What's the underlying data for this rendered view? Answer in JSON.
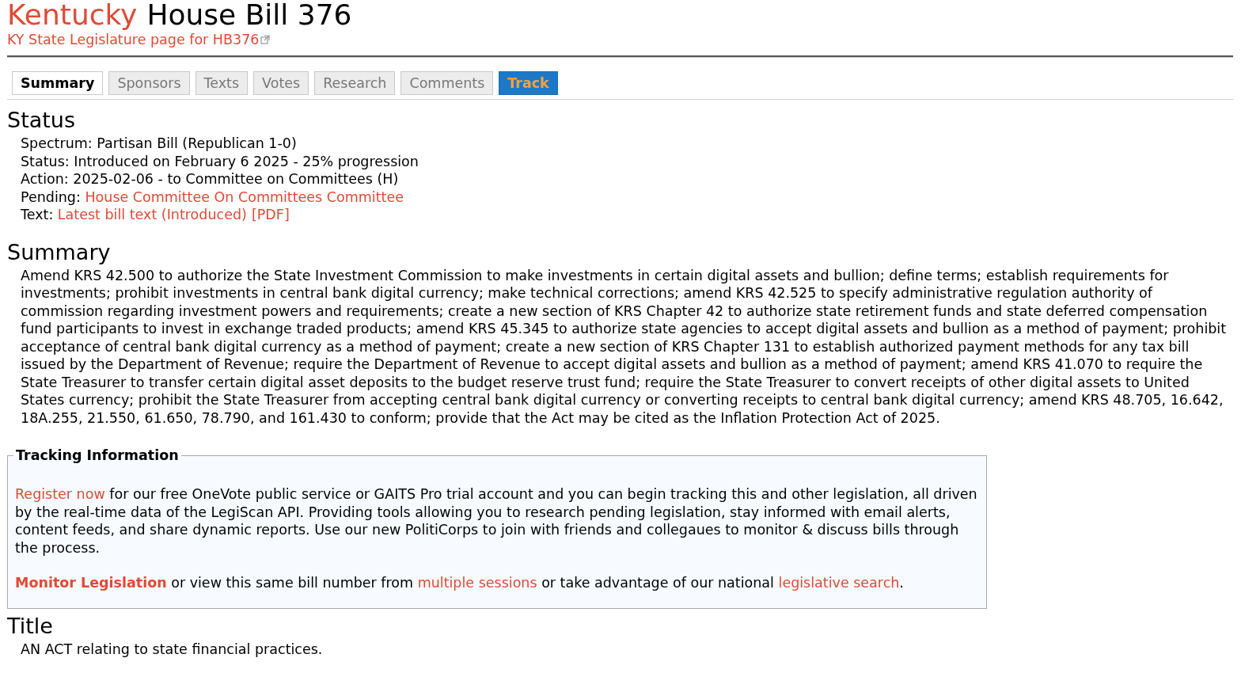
{
  "header": {
    "state": "Kentucky",
    "bill": "House Bill 376",
    "state_link": "KY State Legislature page for HB376"
  },
  "tabs": [
    {
      "label": "Summary",
      "selected": true,
      "kind": "tab"
    },
    {
      "label": "Sponsors",
      "selected": false,
      "kind": "tab"
    },
    {
      "label": "Texts",
      "selected": false,
      "kind": "tab"
    },
    {
      "label": "Votes",
      "selected": false,
      "kind": "tab"
    },
    {
      "label": "Research",
      "selected": false,
      "kind": "tab"
    },
    {
      "label": "Comments",
      "selected": false,
      "kind": "tab"
    },
    {
      "label": "Track",
      "selected": false,
      "kind": "action"
    }
  ],
  "status": {
    "heading": "Status",
    "lines": [
      {
        "parts": [
          {
            "kind": "text",
            "text": "Spectrum: Partisan Bill (Republican 1-0)"
          }
        ]
      },
      {
        "parts": [
          {
            "kind": "text",
            "text": "Status: Introduced on February 6 2025 - 25% progression"
          }
        ]
      },
      {
        "parts": [
          {
            "kind": "text",
            "text": "Action: 2025-02-06 - to Committee on Committees (H)"
          }
        ]
      },
      {
        "parts": [
          {
            "kind": "text",
            "text": "Pending: "
          },
          {
            "kind": "link",
            "text": "House Committee On Committees Committee"
          }
        ]
      },
      {
        "parts": [
          {
            "kind": "text",
            "text": "Text: "
          },
          {
            "kind": "link",
            "text": "Latest bill text (Introduced)"
          },
          {
            "kind": "link",
            "text": "[PDF]"
          }
        ]
      }
    ]
  },
  "summary": {
    "heading": "Summary",
    "text": "Amend KRS 42.500 to authorize the State Investment Commission to make investments in certain digital assets and bullion; define terms; establish requirements for investments; prohibit investments in central bank digital currency; make technical corrections; amend KRS 42.525 to specify administrative regulation authority of commission regarding investment powers and requirements; create a new section of KRS Chapter 42 to authorize state retirement funds and state deferred compensation fund participants to invest in exchange traded products; amend KRS 45.345 to authorize state agencies to accept digital assets and bullion as a method of payment; prohibit acceptance of central bank digital currency as a method of payment; create a new section of KRS Chapter 131 to establish authorized payment methods for any tax bill issued by the Department of Revenue; require the Department of Revenue to accept digital assets and bullion as a method of payment; amend KRS 41.070 to require the State Treasurer to transfer certain digital asset deposits to the budget reserve trust fund; require the State Treasurer to convert receipts of other digital assets to United States currency; prohibit the State Treasurer from accepting central bank digital currency or converting receipts to central bank digital currency; amend KRS 48.705, 16.642, 18A.255, 21.550, 61.650, 78.790, and 161.430 to conform; provide that the Act may be cited as the Inflation Protection Act of 2025."
  },
  "tracking": {
    "legend": "Tracking Information",
    "paragraphs": [
      {
        "parts": [
          {
            "kind": "link",
            "text": "Register now"
          },
          {
            "kind": "text",
            "text": " for our free OneVote public service or GAITS Pro trial account and you can begin tracking this and other legislation, all driven by the real-time data of the LegiScan API. Providing tools allowing you to research pending legislation, stay informed with email alerts, content feeds, and share dynamic reports. Use our new PolitiCorps to join with friends and collegaues to monitor & discuss bills through the process."
          }
        ]
      },
      {
        "parts": [
          {
            "kind": "strong-link",
            "text": "Monitor Legislation"
          },
          {
            "kind": "text",
            "text": " or view this same bill number from "
          },
          {
            "kind": "link",
            "text": "multiple sessions"
          },
          {
            "kind": "text",
            "text": " or take advantage of our national "
          },
          {
            "kind": "link",
            "text": "legislative search"
          },
          {
            "kind": "text",
            "text": "."
          }
        ]
      }
    ]
  },
  "title": {
    "heading": "Title",
    "text": "AN ACT relating to state financial practices."
  }
}
